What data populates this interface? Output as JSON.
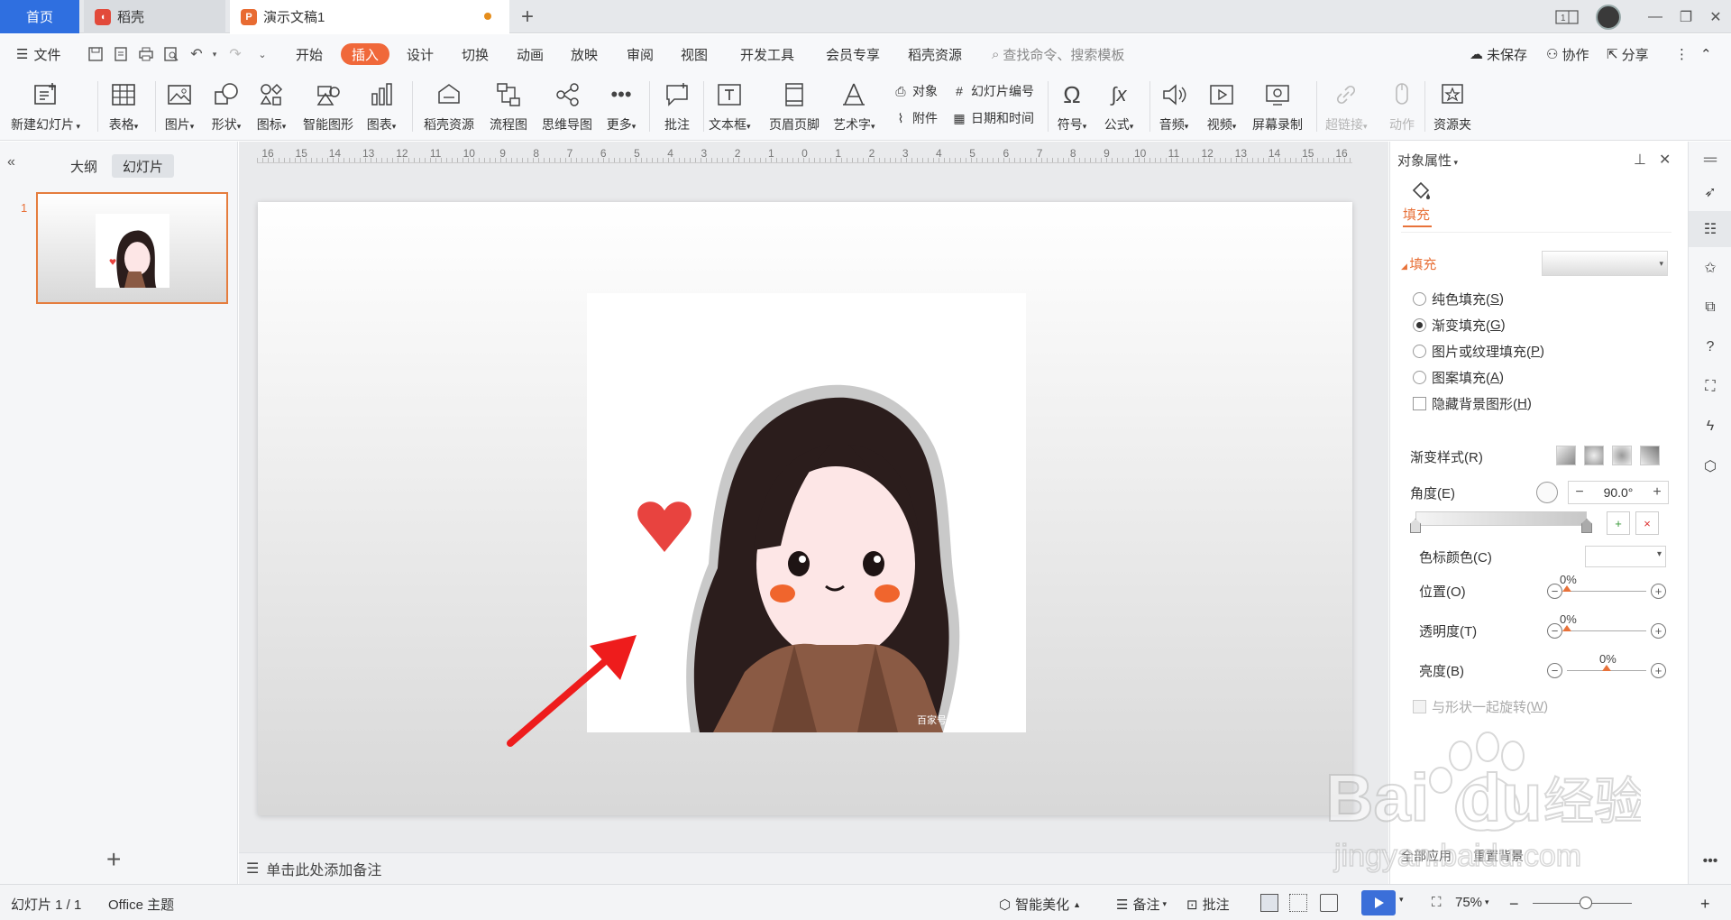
{
  "tabs": {
    "home": "首页",
    "daoke": "稻壳",
    "doc": "演示文稿1"
  },
  "menu": {
    "file": "文件",
    "items": [
      "开始",
      "插入",
      "设计",
      "切换",
      "动画",
      "放映",
      "审阅",
      "视图",
      "开发工具",
      "会员专享",
      "稻壳资源"
    ],
    "active": "插入",
    "search_placeholder": "查找命令、搜索模板",
    "unsaved": "未保存",
    "collab": "协作",
    "share": "分享"
  },
  "ribbon": {
    "new_slide": "新建幻灯片",
    "table": "表格",
    "picture": "图片",
    "shape": "形状",
    "icon": "图标",
    "smart_shape": "智能图形",
    "chart": "图表",
    "daoke_res": "稻壳资源",
    "flowchart": "流程图",
    "mindmap": "思维导图",
    "more": "更多",
    "comment": "批注",
    "textbox": "文本框",
    "header_footer": "页眉页脚",
    "wordart": "艺术字",
    "object": "对象",
    "slide_number": "幻灯片编号",
    "attachment": "附件",
    "date_time": "日期和时间",
    "symbol": "符号",
    "formula": "公式",
    "audio": "音频",
    "video": "视频",
    "screen_record": "屏幕录制",
    "hyperlink": "超链接",
    "action": "动作",
    "resource": "资源夹"
  },
  "left_panel": {
    "outline_tab": "大纲",
    "slides_tab": "幻灯片",
    "slide_number": "1"
  },
  "ruler": [
    "16",
    "15",
    "14",
    "13",
    "12",
    "11",
    "10",
    "9",
    "8",
    "7",
    "6",
    "5",
    "4",
    "3",
    "2",
    "1",
    "0",
    "1",
    "2",
    "3",
    "4",
    "5",
    "6",
    "7",
    "8",
    "9",
    "10",
    "11",
    "12",
    "13",
    "14",
    "15",
    "16"
  ],
  "slide": {
    "image_watermark": "百家号"
  },
  "notes_placeholder": "单击此处添加备注",
  "properties": {
    "title": "对象属性",
    "fill_tab": "填充",
    "fill_section": "填充",
    "options": [
      {
        "label": "纯色填充(",
        "key": "S",
        "end": ")",
        "checked": false
      },
      {
        "label": "渐变填充(",
        "key": "G",
        "end": ")",
        "checked": true
      },
      {
        "label": "图片或纹理填充(",
        "key": "P",
        "end": ")",
        "checked": false
      },
      {
        "label": "图案填充(",
        "key": "A",
        "end": ")",
        "checked": false
      }
    ],
    "hide_bg": {
      "label": "隐藏背景图形(",
      "key": "H",
      "end": ")"
    },
    "gradient_style": "渐变样式(R)",
    "angle_label": "角度(E)",
    "angle_value": "90.0°",
    "stop_color": "色标颜色(C)",
    "position_label": "位置(O)",
    "position_value": "0%",
    "transparency_label": "透明度(T)",
    "transparency_value": "0%",
    "brightness_label": "亮度(B)",
    "brightness_value": "0%",
    "rotate_with_shape": {
      "label": "与形状一起旋转(",
      "key": "W",
      "end": ")"
    },
    "apply_all": "全部应用",
    "reset_bg": "重置背景"
  },
  "watermark": {
    "brand": "Bai",
    "brand2": "du",
    "cn": "经验",
    "url": "jingyan.baidu.com"
  },
  "status": {
    "slide_pos": "幻灯片 1 / 1",
    "theme": "Office 主题",
    "beautify": "智能美化",
    "notes": "备注",
    "comment": "批注",
    "zoom": "75%"
  },
  "colors": {
    "accent": "#f0683a",
    "home_tab": "#2f6fe0",
    "play": "#3b6fd9",
    "arrow": "#ee1c1c"
  }
}
